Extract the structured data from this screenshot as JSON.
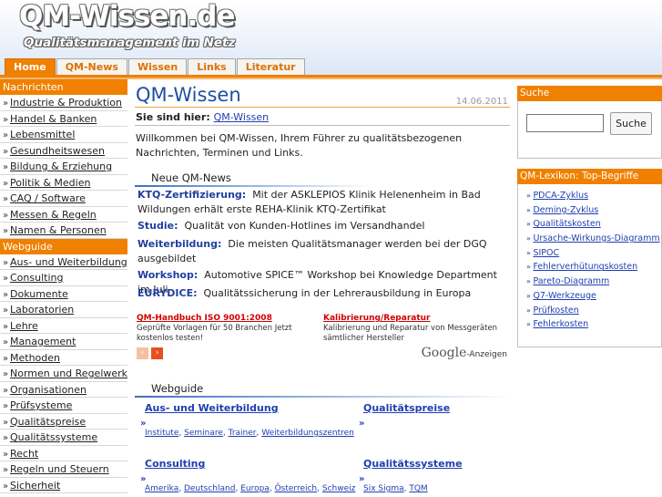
{
  "header": {
    "logo_title": "QM-Wissen.de",
    "logo_subtitle": "Qualitätsmanagement im Netz"
  },
  "tabs": [
    {
      "label": "Home",
      "active": true
    },
    {
      "label": "QM-News",
      "active": false
    },
    {
      "label": "Wissen",
      "active": false
    },
    {
      "label": "Links",
      "active": false
    },
    {
      "label": "Literatur",
      "active": false
    }
  ],
  "nav": {
    "section1_title": "Nachrichten",
    "section1_items": [
      "Industrie & Produktion",
      "Handel & Banken",
      "Lebensmittel",
      "Gesundheitswesen",
      "Bildung & Erziehung",
      "Politik & Medien",
      "CAQ / Software",
      "Messen & Regeln",
      "Namen & Personen"
    ],
    "section2_title": "Webguide",
    "section2_items": [
      "Aus- und Weiterbildung",
      "Consulting",
      "Dokumente",
      "Laboratorien",
      "Lehre",
      "Management",
      "Methoden",
      "Normen und Regelwerke",
      "Organisationen",
      "Prüfsysteme",
      "Qualitätspreise",
      "Qualitätssysteme",
      "Recht",
      "Regeln und Steuern",
      "Sicherheit"
    ]
  },
  "main": {
    "title": "QM-Wissen",
    "date": "14.06.2011",
    "breadcrumb_label": "Sie sind hier:",
    "breadcrumb_link": "QM-Wissen",
    "intro": "Willkommen bei QM-Wissen, Ihrem Führer zu qualitätsbezogenen Nachrichten, Terminen und Links.",
    "news_section_title": "Neue QM-News",
    "news": [
      {
        "label": "KTQ-Zertifizierung:",
        "text": "Mit der ASKLEPIOS Klinik Helenenheim in Bad Wildungen erhält erste REHA-Klinik KTQ-Zertifikat"
      },
      {
        "label": "Studie:",
        "text": "Qualität von Kunden-Hotlines im Versandhandel"
      },
      {
        "label": "Weiterbildung:",
        "text": "Die meisten Qualitätsmanager werden bei der DGQ ausgebildet"
      },
      {
        "label": "Workshop:",
        "text": "Automotive SPICE™ Workshop bei Knowledge Department im Juli"
      },
      {
        "label": "EURYDICE:",
        "text": "Qualitätssicherung in der Lehrerausbildung in Europa"
      }
    ],
    "ads": [
      {
        "title": "QM-Handbuch ISO 9001:2008",
        "text": "Geprüfte Vorlagen für 50 Branchen Jetzt kostenlos testen!"
      },
      {
        "title": "Kalibrierung/Reparatur",
        "text": "Kalibrierung und Reparatur von Messgeräten sämtlicher Hersteller"
      }
    ],
    "ad_prev": "‹",
    "ad_next": "›",
    "google_brand": "Google",
    "google_suffix": "-Anzeigen",
    "webguide_section_title": "Webguide",
    "webguide": [
      {
        "title": "Aus- und Weiterbildung",
        "links": [
          "Institute",
          "Seminare",
          "Trainer",
          "Weiterbildungszentren"
        ]
      },
      {
        "title": "Qualitätspreise",
        "links": []
      },
      {
        "title": "Consulting",
        "links": [
          "Amerika",
          "Deutschland",
          "Europa",
          "Österreich",
          "Schweiz"
        ]
      },
      {
        "title": "Qualitätssysteme",
        "links": [
          "Six Sigma",
          "TQM"
        ]
      }
    ]
  },
  "right": {
    "search_title": "Suche",
    "search_button": "Suche",
    "search_value": "",
    "lexikon_title": "QM-Lexikon: Top-Begriffe",
    "lexikon_items": [
      "PDCA-Zyklus",
      "Deming-Zyklus",
      "Qualitätskosten",
      "Ursache-Wirkungs-Diagramm",
      "SIPOC",
      "Fehlerverhütungskosten",
      "Pareto-Diagramm",
      "Q7-Werkzeuge",
      "Prüfkosten",
      "Fehlerkosten"
    ]
  },
  "colors": {
    "accent": "#f08000",
    "link": "#1f3faf",
    "title": "#1f4f9f",
    "ad_title": "#d00000"
  }
}
